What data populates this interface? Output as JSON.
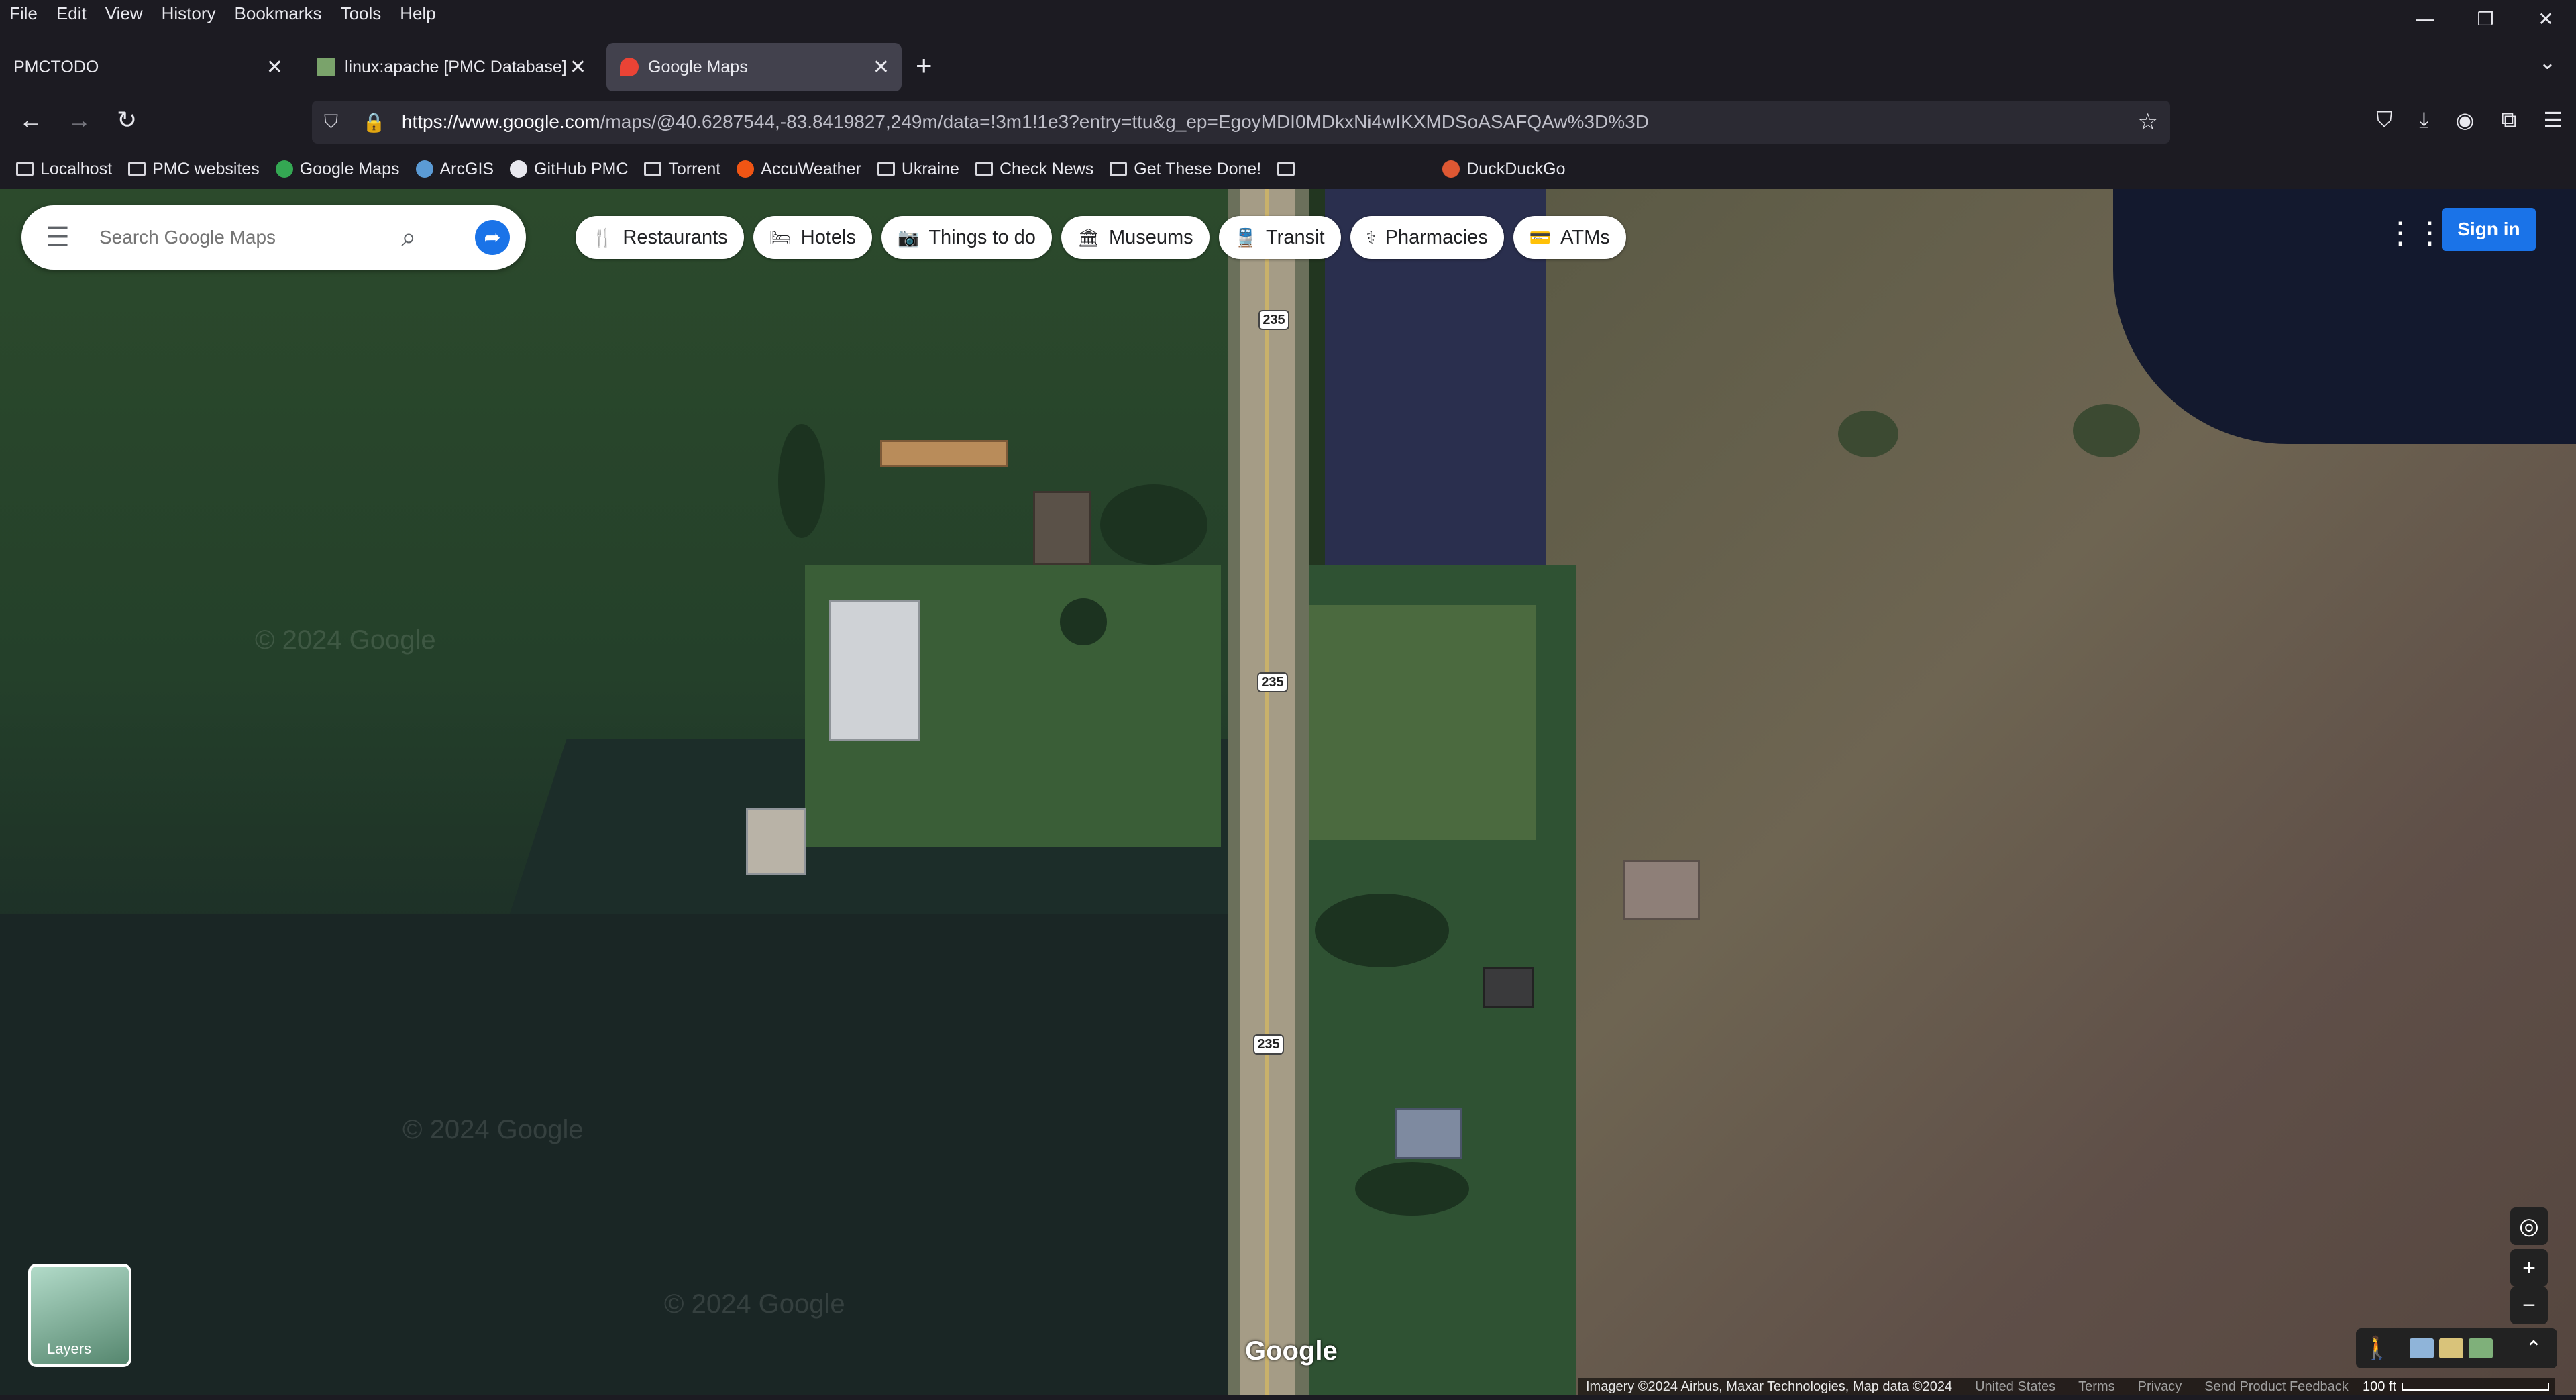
{
  "menu": [
    "File",
    "Edit",
    "View",
    "History",
    "Bookmarks",
    "Tools",
    "Help"
  ],
  "window": {
    "minimize": "—",
    "restore": "❐",
    "close": "✕"
  },
  "tabs": [
    {
      "label": "PMCTODO",
      "active": false
    },
    {
      "label": "linux:apache [PMC Database]",
      "active": false
    },
    {
      "label": "Google Maps",
      "active": true
    }
  ],
  "newtab": "+",
  "url": {
    "domain": "https://www.google.com",
    "path": "/maps/@40.6287544,-83.8419827,249m/data=!3m1!1e3?entry=ttu&g_ep=EgoyMDI0MDkxNi4wIKXMDSoASAFQAw%3D%3D"
  },
  "bookmarks": [
    "Localhost",
    "PMC websites",
    "Google Maps",
    "ArcGIS",
    "GitHub PMC",
    "Torrent",
    "AccuWeather",
    "Ukraine",
    "Check News",
    "Get These Done!",
    "",
    "DuckDuckGo"
  ],
  "search": {
    "placeholder": "Search Google Maps"
  },
  "chips": [
    {
      "label": "Restaurants",
      "icon": "🍴"
    },
    {
      "label": "Hotels",
      "icon": "🛏"
    },
    {
      "label": "Things to do",
      "icon": "📷"
    },
    {
      "label": "Museums",
      "icon": "🏛"
    },
    {
      "label": "Transit",
      "icon": "🚆"
    },
    {
      "label": "Pharmacies",
      "icon": "⚕"
    },
    {
      "label": "ATMs",
      "icon": "💳"
    }
  ],
  "signin": "Sign in",
  "layers_label": "Layers",
  "route_shield": "235",
  "watermark": "© 2024 Google",
  "logo": "Google",
  "attribution": {
    "imagery": "Imagery ©2024 Airbus, Maxar Technologies, Map data ©2024",
    "country": "United States",
    "terms": "Terms",
    "privacy": "Privacy",
    "feedback": "Send Product Feedback"
  },
  "scale": "100 ft",
  "colors": {
    "accent": "#1a73e8",
    "chrome_bg": "#1c1b22",
    "active_tab": "#42414d"
  }
}
